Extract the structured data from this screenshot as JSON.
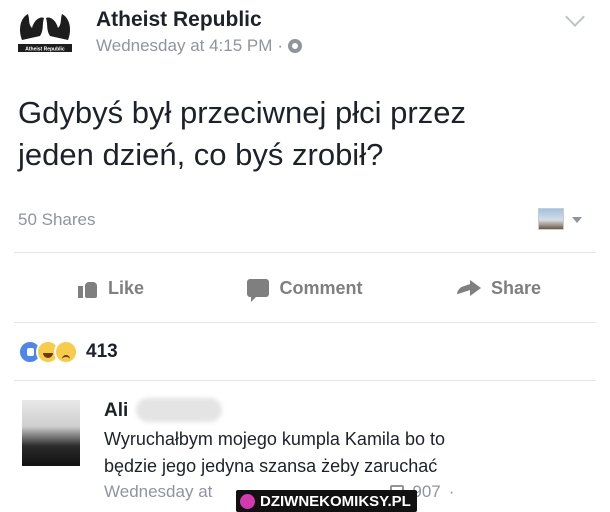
{
  "post": {
    "page_name": "Atheist Republic",
    "timestamp": "Wednesday at 4:15 PM",
    "separator": "·",
    "logo_text": "Atheist Republic",
    "text_line1": "Gdybyś był przeciwnej płci przez",
    "text_line2": "jeden dzień, co byś zrobił?",
    "shares": "50 Shares",
    "icons": {
      "privacy": "globe-icon",
      "options": "chevron-down-icon"
    }
  },
  "actions": {
    "like": "Like",
    "comment": "Comment",
    "share": "Share"
  },
  "reactions": {
    "types": [
      "like",
      "haha",
      "sad"
    ],
    "count": "413"
  },
  "comment": {
    "author": "Ali",
    "line1": "Wyruchałbym mojego kumpla Kamila bo to",
    "line2": "będzie jego jedyna szansa żeby zaruchać",
    "timestamp": "Wednesday at",
    "likes": "907",
    "dot": "·"
  },
  "watermark": {
    "text": "DZIWNEKOMIKSY.PL"
  },
  "colors": {
    "text": "#1d2129",
    "muted": "#90949c",
    "like_blue": "#4e86f0",
    "emoji_yellow": "#f7cc4a"
  }
}
